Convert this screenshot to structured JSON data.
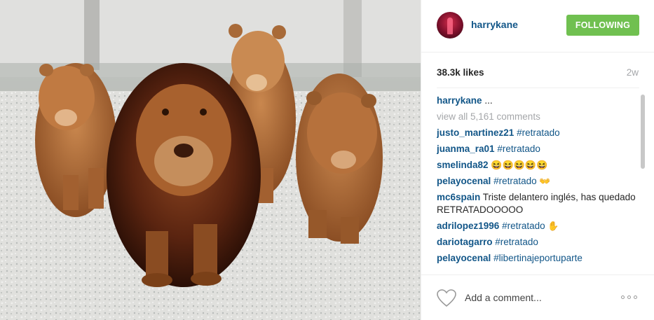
{
  "photo": {
    "icon": "lions-photo"
  },
  "header": {
    "username": "harrykane",
    "follow_label": "FOLLOWING"
  },
  "stats": {
    "likes": "38.3k likes",
    "time": "2w"
  },
  "caption": {
    "user": "harrykane",
    "text": "..."
  },
  "view_all": "view all 5,161 comments",
  "comments": [
    {
      "user": "justo_martinez21",
      "hashtag": "#retratado",
      "text": "",
      "emoji": ""
    },
    {
      "user": "juanma_ra01",
      "hashtag": "#retratado",
      "text": "",
      "emoji": ""
    },
    {
      "user": "smelinda82",
      "hashtag": "",
      "text": "",
      "emoji": "😆😆😆😆😆"
    },
    {
      "user": "pelayocenal",
      "hashtag": "#retratado",
      "text": "",
      "emoji": "👐"
    },
    {
      "user": "mc6spain",
      "hashtag": "",
      "text": "Triste delantero inglés, has quedado RETRATADOOOOO",
      "emoji": ""
    },
    {
      "user": "adrilopez1996",
      "hashtag": "#retratado",
      "text": "",
      "emoji": "✋"
    },
    {
      "user": "dariotagarro",
      "hashtag": "#retratado",
      "text": "",
      "emoji": ""
    },
    {
      "user": "pelayocenal",
      "hashtag": "#libertinajeportuparte",
      "text": "",
      "emoji": ""
    }
  ],
  "footer": {
    "placeholder": "Add a comment..."
  },
  "colors": {
    "link": "#125688",
    "follow_bg": "#70c050",
    "muted": "#a5a7aa"
  }
}
